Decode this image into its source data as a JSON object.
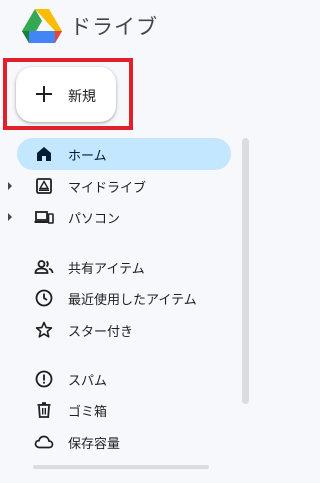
{
  "app": {
    "title": "ドライブ"
  },
  "new_button": {
    "label": "新規"
  },
  "colors": {
    "highlight": "#e0202a",
    "active_bg": "#c2e7ff",
    "background": "#f6f8fc"
  },
  "nav": {
    "items": [
      {
        "label": "ホーム",
        "icon": "home-icon",
        "active": true
      },
      {
        "label": "マイドライブ",
        "icon": "my-drive-icon",
        "expandable": true
      },
      {
        "label": "パソコン",
        "icon": "computers-icon",
        "expandable": true
      },
      {
        "label": "共有アイテム",
        "icon": "shared-icon"
      },
      {
        "label": "最近使用したアイテム",
        "icon": "recent-icon"
      },
      {
        "label": "スター付き",
        "icon": "star-icon"
      },
      {
        "label": "スパム",
        "icon": "spam-icon"
      },
      {
        "label": "ゴミ箱",
        "icon": "trash-icon"
      },
      {
        "label": "保存容量",
        "icon": "cloud-icon"
      }
    ]
  }
}
